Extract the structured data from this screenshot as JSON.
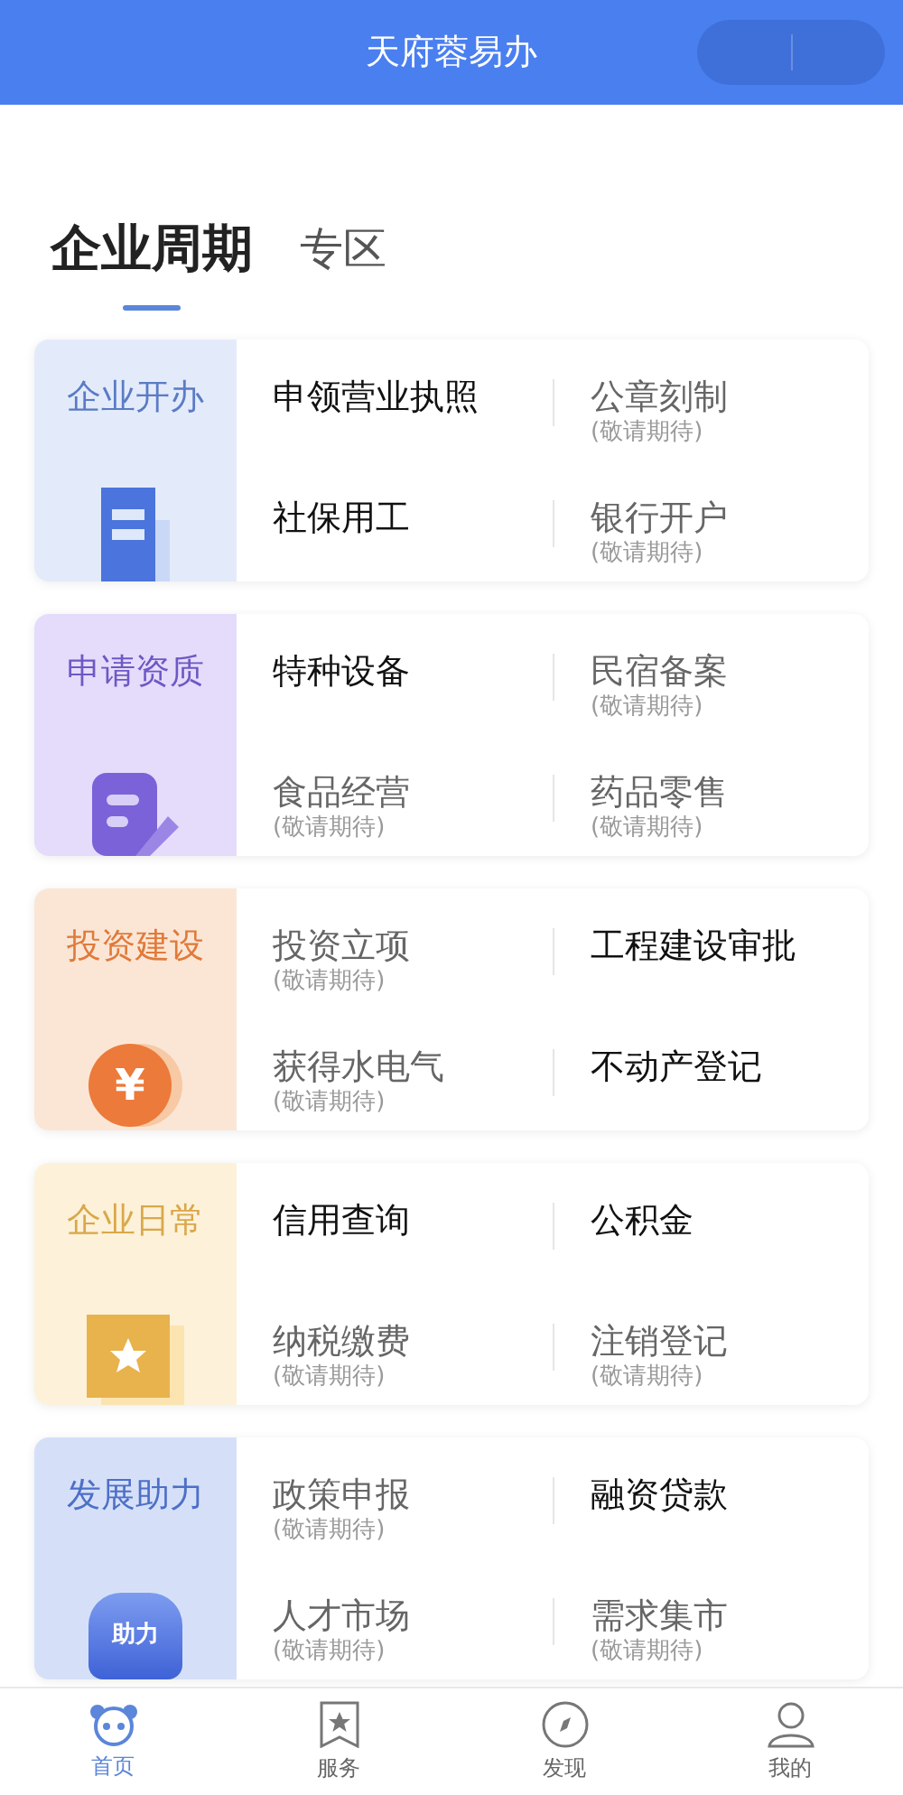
{
  "header": {
    "title": "天府蓉易办"
  },
  "tabs": [
    {
      "label": "企业周期",
      "selected": true
    },
    {
      "label": "专区",
      "selected": false
    }
  ],
  "cards": [
    {
      "title": "企业开办",
      "kind": "building",
      "items": [
        {
          "label": "申领营业执照",
          "disabled": false
        },
        {
          "label": "公章刻制",
          "disabled": true,
          "note": "(敬请期待)"
        },
        {
          "label": "社保用工",
          "disabled": false
        },
        {
          "label": "银行开户",
          "disabled": true,
          "note": "(敬请期待)"
        }
      ]
    },
    {
      "title": "申请资质",
      "kind": "edit",
      "items": [
        {
          "label": "特种设备",
          "disabled": false
        },
        {
          "label": "民宿备案",
          "disabled": true,
          "note": "(敬请期待)"
        },
        {
          "label": "食品经营",
          "disabled": true,
          "note": "(敬请期待)"
        },
        {
          "label": "药品零售",
          "disabled": true,
          "note": "(敬请期待)"
        }
      ]
    },
    {
      "title": "投资建设",
      "kind": "yuan",
      "icon_text": "¥",
      "items": [
        {
          "label": "投资立项",
          "disabled": true,
          "note": "(敬请期待)"
        },
        {
          "label": "工程建设审批",
          "disabled": false
        },
        {
          "label": "获得水电气",
          "disabled": true,
          "note": "(敬请期待)"
        },
        {
          "label": "不动产登记",
          "disabled": false
        }
      ]
    },
    {
      "title": "企业日常",
      "kind": "star",
      "items": [
        {
          "label": "信用查询",
          "disabled": false
        },
        {
          "label": "公积金",
          "disabled": false
        },
        {
          "label": "纳税缴费",
          "disabled": true,
          "note": "(敬请期待)"
        },
        {
          "label": "注销登记",
          "disabled": true,
          "note": "(敬请期待)"
        }
      ]
    },
    {
      "title": "发展助力",
      "kind": "fist",
      "icon_text": "助力",
      "items": [
        {
          "label": "政策申报",
          "disabled": true,
          "note": "(敬请期待)"
        },
        {
          "label": "融资贷款",
          "disabled": false
        },
        {
          "label": "人才市场",
          "disabled": true,
          "note": "(敬请期待)"
        },
        {
          "label": "需求集市",
          "disabled": true,
          "note": "(敬请期待)"
        }
      ]
    }
  ],
  "nav": [
    {
      "label": "首页",
      "kind": "home",
      "selected": true
    },
    {
      "label": "服务",
      "kind": "service",
      "selected": false
    },
    {
      "label": "发现",
      "kind": "discover",
      "selected": false
    },
    {
      "label": "我的",
      "kind": "me",
      "selected": false
    }
  ]
}
